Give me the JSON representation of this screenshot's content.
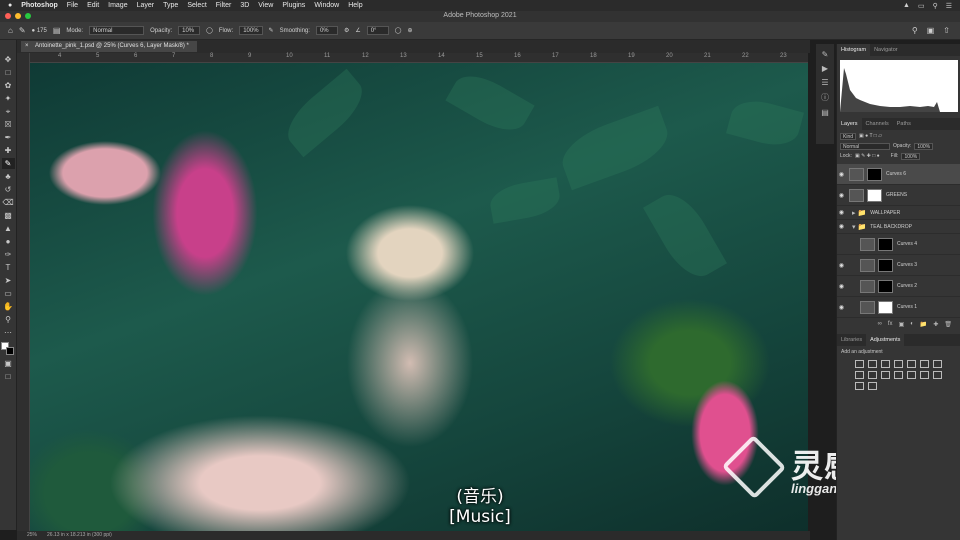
{
  "menubar": {
    "apple": "",
    "app": "Photoshop",
    "items": [
      "File",
      "Edit",
      "Image",
      "Layer",
      "Type",
      "Select",
      "Filter",
      "3D",
      "View",
      "Plugins",
      "Window",
      "Help"
    ]
  },
  "window": {
    "title": "Adobe Photoshop 2021"
  },
  "options": {
    "brush_size": "175",
    "mode_label": "Mode:",
    "mode_value": "Normal",
    "opacity_label": "Opacity:",
    "opacity_value": "10%",
    "flow_label": "Flow:",
    "flow_value": "100%",
    "smoothing_label": "Smoothing:",
    "smoothing_value": "0%",
    "angle_value": "0°"
  },
  "document": {
    "tab_title": "Antoinette_pink_1.psd @ 25% (Curves 6, Layer Mask/8) *",
    "zoom": "25%",
    "dimensions": "26.13 in x 18.213 in (300 ppi)"
  },
  "ruler": {
    "top_ticks": [
      "4",
      "5",
      "6",
      "7",
      "8",
      "9",
      "10",
      "11",
      "12",
      "13",
      "14",
      "15",
      "16",
      "17",
      "18",
      "19",
      "20",
      "21",
      "22",
      "23"
    ]
  },
  "panels": {
    "top_tabs": [
      "Histogram",
      "Navigator"
    ],
    "layers_tabs": [
      "Layers",
      "Channels",
      "Paths"
    ],
    "kind_label": "Kind",
    "blend_mode": "Normal",
    "opacity_label": "Opacity:",
    "opacity_value": "100%",
    "lock_label": "Lock:",
    "fill_label": "Fill:",
    "fill_value": "100%",
    "layers": [
      {
        "name": "Curves 6",
        "thumb": "black",
        "selected": true,
        "type": "adjustment"
      },
      {
        "name": "GREENS",
        "thumb": "white",
        "selected": false,
        "type": "adjustment"
      },
      {
        "name": "WALLPAPER",
        "thumb": "",
        "selected": false,
        "type": "group"
      },
      {
        "name": "TEAL BACKDROP",
        "thumb": "",
        "selected": false,
        "type": "group"
      },
      {
        "name": "Curves 4",
        "thumb": "black",
        "selected": false,
        "type": "adjustment"
      },
      {
        "name": "Curves 3",
        "thumb": "black",
        "selected": false,
        "type": "adjustment"
      },
      {
        "name": "Curves 2",
        "thumb": "black",
        "selected": false,
        "type": "adjustment"
      },
      {
        "name": "Curves 1",
        "thumb": "white",
        "selected": false,
        "type": "adjustment"
      }
    ],
    "bottom_tabs": [
      "Libraries",
      "Adjustments"
    ],
    "add_adjustment": "Add an adjustment"
  },
  "subtitles": {
    "line1": "(音乐)",
    "line2": "[Music]"
  },
  "watermark": {
    "cn": "灵感中国",
    "en": "lingganchina.com"
  },
  "colors": {
    "accent_fg": "#ffffff",
    "accent_bg": "#000000",
    "panel": "#353535"
  }
}
